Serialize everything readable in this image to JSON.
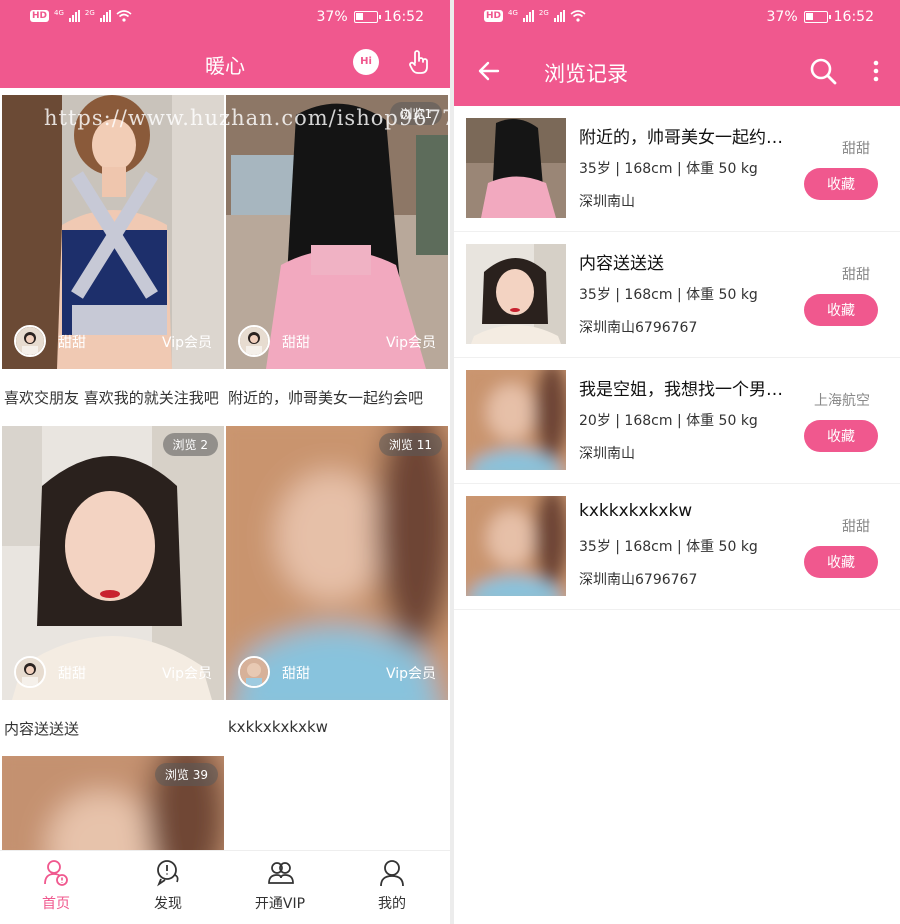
{
  "status": {
    "battery": "37%",
    "time": "16:52",
    "hd": "HD",
    "net1": "4G",
    "net2": "2G",
    "battery_fill": 0.37
  },
  "home": {
    "title": "暖心",
    "hi_label": "Hi",
    "watermark": "https://www.huzhan.com/ishop9677",
    "cards": [
      {
        "views": "浏览1",
        "name": "甜甜",
        "vip": "Vip会员",
        "caption": "喜欢交朋友 喜欢我的就关注我吧"
      },
      {
        "views": "浏览1",
        "name": "甜甜",
        "vip": "Vip会员",
        "caption": "附近的，帅哥美女一起约会吧"
      },
      {
        "views": "浏览 2",
        "name": "甜甜",
        "vip": "Vip会员",
        "caption": "内容送送送"
      },
      {
        "views": "浏览 11",
        "name": "甜甜",
        "vip": "Vip会员",
        "caption": "kxkkxkxkxkw"
      },
      {
        "views": "浏览 39",
        "name": "",
        "vip": "",
        "caption": ""
      }
    ],
    "nav": [
      {
        "label": "首页",
        "icon": "home-user-icon",
        "active": true
      },
      {
        "label": "发现",
        "icon": "discover-chat-icon",
        "active": false
      },
      {
        "label": "开通VIP",
        "icon": "vip-users-icon",
        "active": false
      },
      {
        "label": "我的",
        "icon": "profile-icon",
        "active": false
      }
    ]
  },
  "history": {
    "title": "浏览记录",
    "icons": {
      "back": "back-arrow-icon",
      "search": "search-icon",
      "more": "more-vertical-icon"
    },
    "items": [
      {
        "title": "附近的，帅哥美女一起约会吧",
        "meta": "35岁 | 168cm | 体重 50 kg",
        "location": "深圳南山",
        "name": "甜甜",
        "button": "收藏"
      },
      {
        "title": "内容送送送",
        "meta": "35岁 | 168cm | 体重 50 kg",
        "location": "深圳南山6796767",
        "name": "甜甜",
        "button": "收藏"
      },
      {
        "title": "我是空姐，我想找一个男朋友",
        "meta": "20岁 | 168cm | 体重 50 kg",
        "location": "深圳南山",
        "name": "上海航空",
        "button": "收藏"
      },
      {
        "title": "kxkkxkxkxkw",
        "meta": "35岁 | 168cm | 体重 50 kg",
        "location": "深圳南山6796767",
        "name": "甜甜",
        "button": "收藏"
      }
    ]
  },
  "colors": {
    "accent": "#f0588e"
  }
}
